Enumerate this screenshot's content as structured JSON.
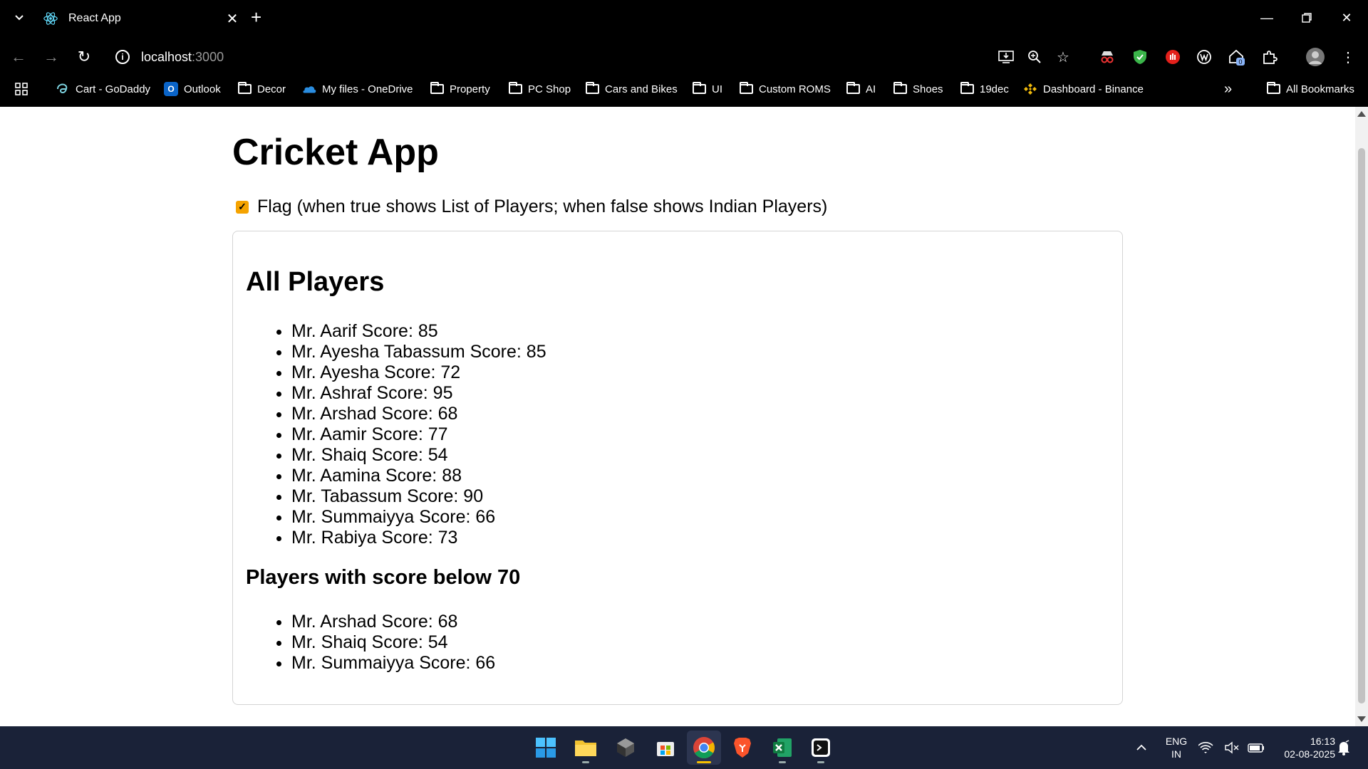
{
  "browser": {
    "tab_title": "React App",
    "url_host": "localhost",
    "url_port": ":3000",
    "bookmarks": [
      {
        "label": "Cart - GoDaddy",
        "icon": "godaddy-icon"
      },
      {
        "label": "Outlook",
        "icon": "outlook-icon"
      },
      {
        "label": "Decor",
        "icon": "folder-icon"
      },
      {
        "label": "My files - OneDrive",
        "icon": "onedrive-icon"
      },
      {
        "label": "Property",
        "icon": "folder-icon"
      },
      {
        "label": "PC Shop",
        "icon": "folder-icon"
      },
      {
        "label": "Cars and Bikes",
        "icon": "folder-icon"
      },
      {
        "label": "UI",
        "icon": "folder-icon"
      },
      {
        "label": "Custom ROMS",
        "icon": "folder-icon"
      },
      {
        "label": "AI",
        "icon": "folder-icon"
      },
      {
        "label": "Shoes",
        "icon": "folder-icon"
      },
      {
        "label": "19dec",
        "icon": "folder-icon"
      },
      {
        "label": "Dashboard - Binance",
        "icon": "binance-icon"
      }
    ],
    "all_bookmarks": "All Bookmarks",
    "extension_badge": "0"
  },
  "page": {
    "title": "Cricket App",
    "flag_checked": true,
    "flag_label": "Flag (when true shows List of Players; when false shows Indian Players)",
    "all_heading": "All Players",
    "all_players": [
      "Mr. Aarif Score: 85",
      "Mr. Ayesha Tabassum Score: 85",
      "Mr. Ayesha Score: 72",
      "Mr. Ashraf Score: 95",
      "Mr. Arshad Score: 68",
      "Mr. Aamir Score: 77",
      "Mr. Shaiq Score: 54",
      "Mr. Aamina Score: 88",
      "Mr. Tabassum Score: 90",
      "Mr. Summaiyya Score: 66",
      "Mr. Rabiya Score: 73"
    ],
    "below_heading": "Players with score below 70",
    "below_players": [
      "Mr. Arshad Score: 68",
      "Mr. Shaiq Score: 54",
      "Mr. Summaiyya Score: 66"
    ]
  },
  "taskbar": {
    "lang_top": "ENG",
    "lang_bottom": "IN",
    "time": "16:13",
    "date": "02-08-2025"
  },
  "colors": {
    "checkbox_accent": "#f5a300",
    "taskbar_bg": "#1a2238"
  }
}
